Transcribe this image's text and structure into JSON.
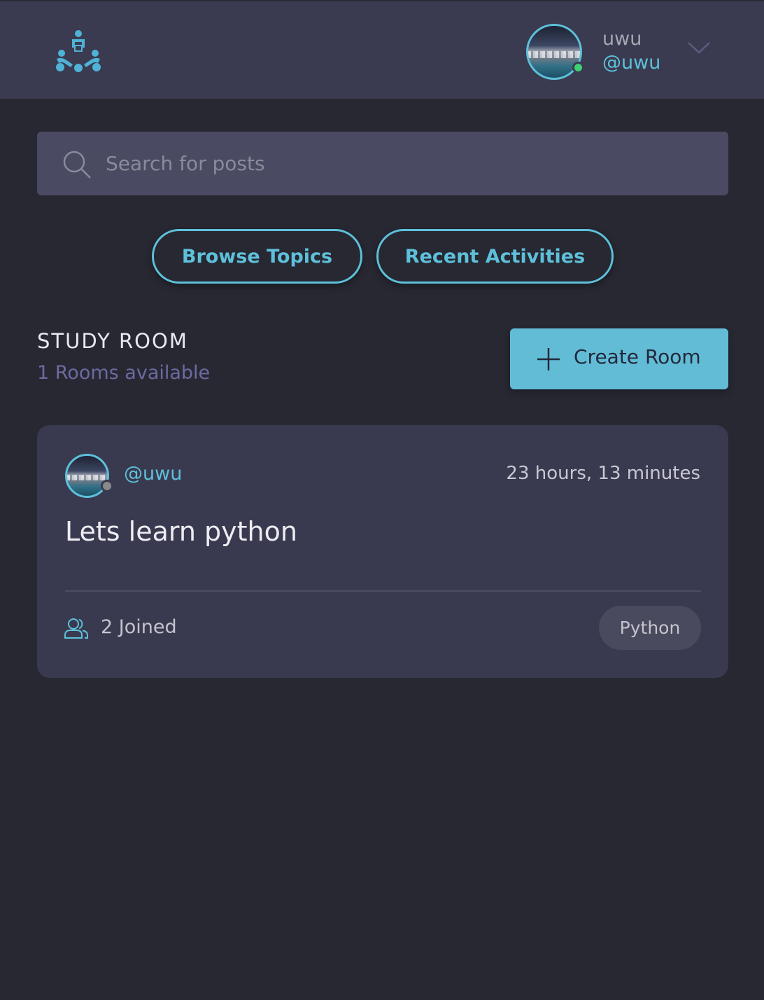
{
  "header": {
    "logo_icon": "study-group-logo-icon",
    "user": {
      "name": "uwu",
      "handle": "@uwu",
      "status": "online"
    },
    "menu_icon": "chevron-down-icon"
  },
  "search": {
    "icon": "search-icon",
    "placeholder": "Search for posts",
    "value": ""
  },
  "nav_pills": {
    "browse_topics": "Browse Topics",
    "recent_activities": "Recent Activities"
  },
  "study_room": {
    "title": "STUDY ROOM",
    "subtitle": "1 Rooms available",
    "create_button": "Create Room",
    "rooms": [
      {
        "host_handle": "@uwu",
        "host_status": "offline",
        "time": "23 hours, 13 minutes",
        "title": "Lets learn python",
        "joined": "2 Joined",
        "topic": "Python"
      }
    ]
  },
  "colors": {
    "background": "#272832",
    "topbar": "#3a3b50",
    "accent": "#5ec0da",
    "card": "#393a4f",
    "online": "#3fcf74"
  }
}
